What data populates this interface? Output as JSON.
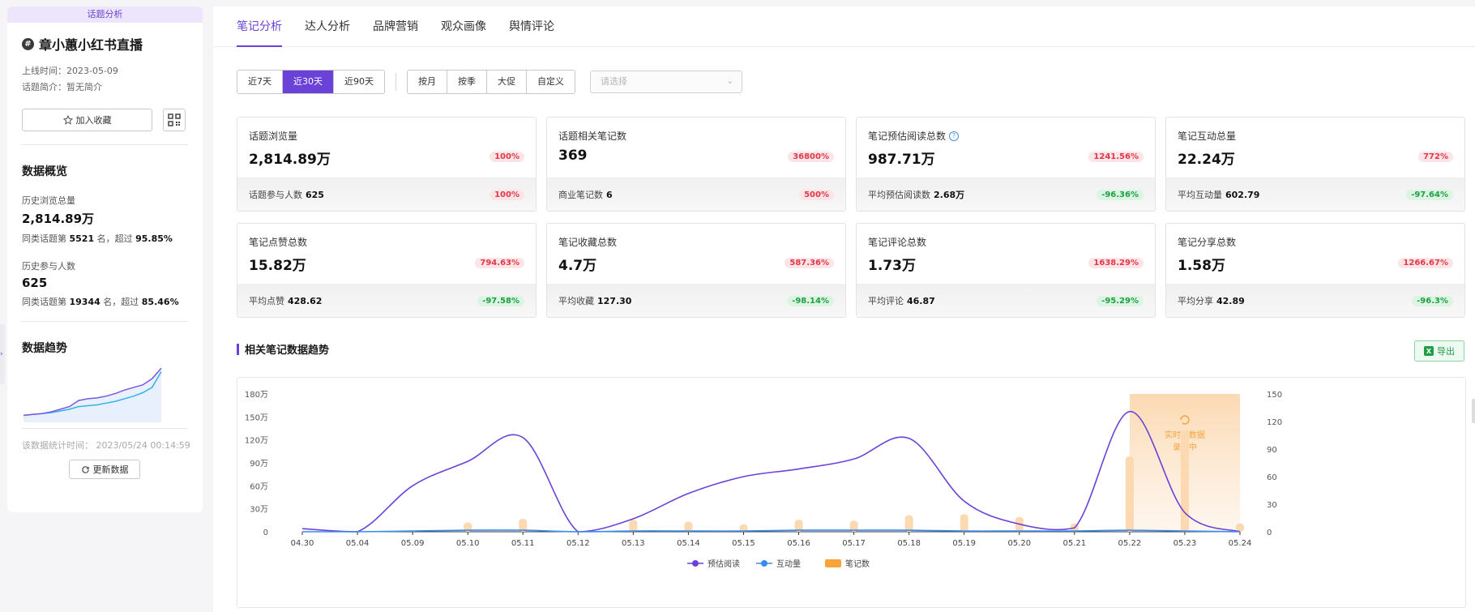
{
  "sidebar": {
    "banner": "话题分析",
    "topic_title": "章小蕙小红书直播",
    "hash_icon": "#",
    "online_time": "上线时间：2023-05-09",
    "intro": "话题简介：暂无简介",
    "fav_label": "加入收藏",
    "overview_title": "数据概览",
    "browse_label": "历史浏览总量",
    "browse_value": "2,814.89万",
    "browse_rank": {
      "prefix": "同类话题第",
      "rank": "5521",
      "mid": "名，超过",
      "pct": "95.85%"
    },
    "participants_label": "历史参与人数",
    "participants_value": "625",
    "participants_rank": {
      "prefix": "同类话题第",
      "rank": "19344",
      "mid": "名，超过",
      "pct": "85.46%"
    },
    "trend_title": "数据趋势",
    "stat_time": "该数据统计时间：   2023/05/24 00:14:59",
    "refresh_label": "更新数据",
    "mini_trend": {
      "series_a": [
        8,
        9,
        10,
        12,
        15,
        18,
        25,
        27,
        28,
        30,
        33,
        37,
        40,
        43,
        50,
        62
      ],
      "series_b": [
        8,
        9,
        10,
        11,
        13,
        15,
        18,
        19,
        20,
        22,
        24,
        27,
        30,
        34,
        40,
        58
      ]
    }
  },
  "tabs": [
    {
      "label": "笔记分析",
      "active": true
    },
    {
      "label": "达人分析",
      "active": false
    },
    {
      "label": "品牌营销",
      "active": false
    },
    {
      "label": "观众画像",
      "active": false
    },
    {
      "label": "舆情评论",
      "active": false
    }
  ],
  "filters": {
    "range": [
      {
        "label": "近7天",
        "active": false
      },
      {
        "label": "近30天",
        "active": true
      },
      {
        "label": "近90天",
        "active": false
      }
    ],
    "period": [
      "按月",
      "按季",
      "大促",
      "自定义"
    ],
    "select_placeholder": "请选择"
  },
  "cards": [
    {
      "label": "话题浏览量",
      "value": "2,814.89万",
      "badge": "100%",
      "badge_color": "red",
      "sub_label": "话题参与人数",
      "sub_value": "625",
      "sub_badge": "100%",
      "sub_badge_color": "red",
      "help": false
    },
    {
      "label": "话题相关笔记数",
      "value": "369",
      "badge": "36800%",
      "badge_color": "red",
      "sub_label": "商业笔记数",
      "sub_value": "6",
      "sub_badge": "500%",
      "sub_badge_color": "red",
      "help": false
    },
    {
      "label": "笔记预估阅读总数",
      "value": "987.71万",
      "badge": "1241.56%",
      "badge_color": "red",
      "sub_label": "平均预估阅读数",
      "sub_value": "2.68万",
      "sub_badge": "-96.36%",
      "sub_badge_color": "green",
      "help": true
    },
    {
      "label": "笔记互动总量",
      "value": "22.24万",
      "badge": "772%",
      "badge_color": "red",
      "sub_label": "平均互动量",
      "sub_value": "602.79",
      "sub_badge": "-97.64%",
      "sub_badge_color": "green",
      "help": false
    },
    {
      "label": "笔记点赞总数",
      "value": "15.82万",
      "badge": "794.63%",
      "badge_color": "red",
      "sub_label": "平均点赞",
      "sub_value": "428.62",
      "sub_badge": "-97.58%",
      "sub_badge_color": "green",
      "help": false
    },
    {
      "label": "笔记收藏总数",
      "value": "4.7万",
      "badge": "587.36%",
      "badge_color": "red",
      "sub_label": "平均收藏",
      "sub_value": "127.30",
      "sub_badge": "-98.14%",
      "sub_badge_color": "green",
      "help": false
    },
    {
      "label": "笔记评论总数",
      "value": "1.73万",
      "badge": "1638.29%",
      "badge_color": "red",
      "sub_label": "平均评论",
      "sub_value": "46.87",
      "sub_badge": "-95.29%",
      "sub_badge_color": "green",
      "help": false
    },
    {
      "label": "笔记分享总数",
      "value": "1.58万",
      "badge": "1266.67%",
      "badge_color": "red",
      "sub_label": "平均分享",
      "sub_value": "42.89",
      "sub_badge": "-96.3%",
      "sub_badge_color": "green",
      "help": false
    }
  ],
  "section_title": "相关笔记数据趋势",
  "export_label": "导出",
  "colors": {
    "accent": "#6a42d8",
    "read": "#6a42d8",
    "interact": "#3b8cee",
    "notes": "#f7a43a",
    "red": "#e0384b",
    "green": "#1f9e44"
  },
  "chart_data": {
    "type": "line",
    "x": [
      "04.30",
      "05.04",
      "05.09",
      "05.10",
      "05.11",
      "05.12",
      "05.13",
      "05.14",
      "05.15",
      "05.16",
      "05.17",
      "05.18",
      "05.19",
      "05.20",
      "05.21",
      "05.22",
      "05.23",
      "05.24"
    ],
    "y_left_ticks": [
      "0",
      "30万",
      "60万",
      "90万",
      "120万",
      "150万",
      "180万"
    ],
    "y_left_range": [
      0,
      180
    ],
    "y_right_ticks": [
      "0",
      "30",
      "60",
      "90",
      "120",
      "150"
    ],
    "y_right_range": [
      0,
      150
    ],
    "series": [
      {
        "name": "预估阅读",
        "axis": "left",
        "kind": "line",
        "values": [
          4,
          0,
          60,
          92,
          123,
          0,
          17,
          50,
          72,
          82,
          95,
          122,
          40,
          10,
          5,
          157,
          25,
          0
        ]
      },
      {
        "name": "互动量",
        "axis": "left",
        "kind": "line",
        "values": [
          0,
          0,
          1,
          2,
          2,
          0,
          1,
          1,
          1,
          2,
          2,
          2,
          1,
          1,
          1,
          2,
          1,
          0
        ]
      },
      {
        "name": "笔记数",
        "axis": "right",
        "kind": "bar",
        "values": [
          0,
          0,
          1,
          10,
          14,
          0,
          13,
          11,
          8,
          13,
          12,
          18,
          19,
          16,
          9,
          82,
          110,
          9
        ]
      }
    ],
    "realtime_note": [
      "实时新数据",
      "录入中"
    ]
  }
}
